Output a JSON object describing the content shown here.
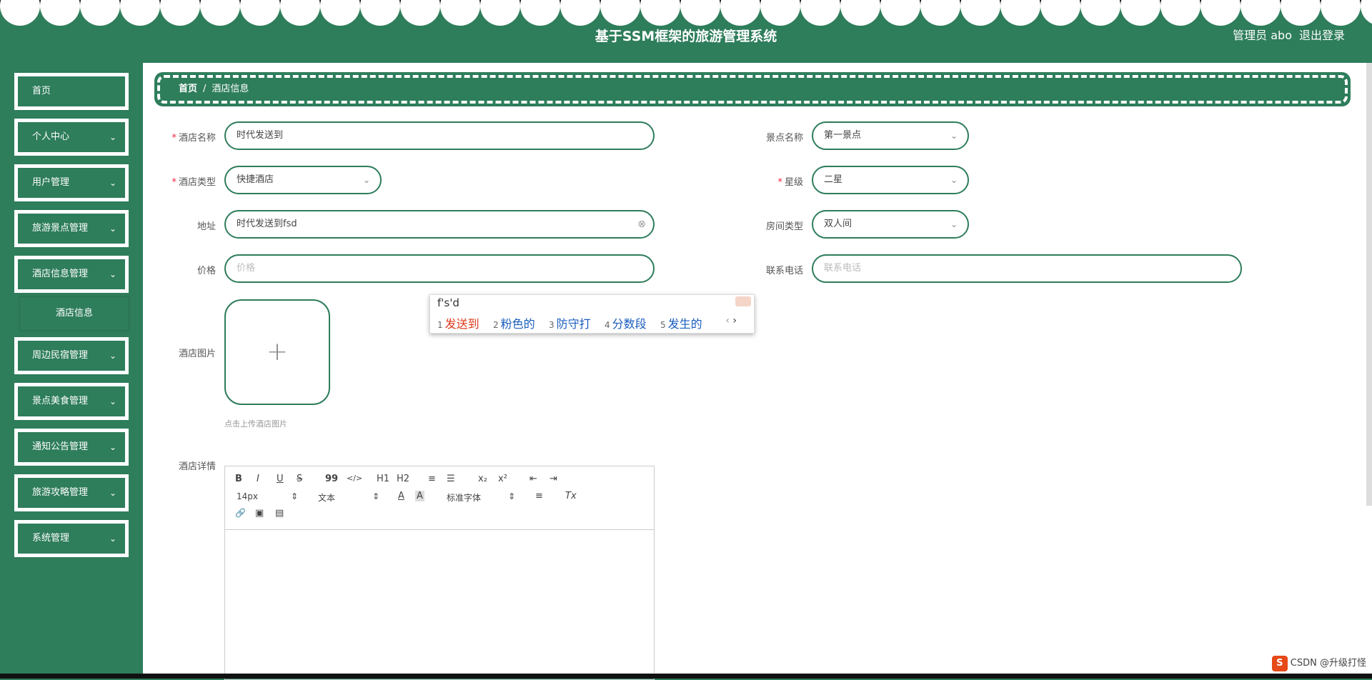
{
  "header": {
    "title": "基于SSM框架的旅游管理系统",
    "user": "管理员 abo",
    "logout": "退出登录"
  },
  "sidebar": {
    "items": [
      {
        "label": "首页"
      },
      {
        "label": "个人中心"
      },
      {
        "label": "用户管理"
      },
      {
        "label": "旅游景点管理"
      },
      {
        "label": "酒店信息管理"
      },
      {
        "label": "周边民宿管理"
      },
      {
        "label": "景点美食管理"
      },
      {
        "label": "通知公告管理"
      },
      {
        "label": "旅游攻略管理"
      },
      {
        "label": "系统管理"
      }
    ],
    "subitem": "酒店信息",
    "chevron": "⌄"
  },
  "breadcrumb": {
    "home": "首页",
    "separator": "/",
    "current": "酒店信息"
  },
  "form": {
    "hotel_name": {
      "label": "酒店名称",
      "value": "时代发送到"
    },
    "scenic_name": {
      "label": "景点名称",
      "value": "第一景点"
    },
    "hotel_type": {
      "label": "酒店类型",
      "value": "快捷酒店"
    },
    "star": {
      "label": "星级",
      "value": "二星"
    },
    "address": {
      "label": "地址",
      "value": "时代发送到fsd"
    },
    "room_type": {
      "label": "房间类型",
      "value": "双人间"
    },
    "price": {
      "label": "价格",
      "placeholder": "价格"
    },
    "phone": {
      "label": "联系电话",
      "placeholder": "联系电话"
    },
    "image": {
      "label": "酒店图片",
      "tip": "点击上传酒店图片",
      "plus": "+"
    },
    "detail": {
      "label": "酒店详情"
    },
    "required_mark": "*"
  },
  "editor": {
    "buttons": [
      "B",
      "I",
      "U",
      "S",
      "99",
      "</>",
      "H1",
      "H2",
      "≡",
      "☰",
      "x₂",
      "x²",
      "⇤",
      "⇥"
    ],
    "font_size": "14px",
    "block": "文本",
    "font_family": "标准字体",
    "misc": [
      "A",
      "A",
      "≡",
      "Tx"
    ],
    "row3": [
      "🔗",
      "▣",
      "▤"
    ]
  },
  "ime": {
    "typed": "f's'd",
    "candidates": [
      {
        "n": "1",
        "text": "发送到"
      },
      {
        "n": "2",
        "text": "粉色的"
      },
      {
        "n": "3",
        "text": "防守打"
      },
      {
        "n": "4",
        "text": "分数段"
      },
      {
        "n": "5",
        "text": "发生的"
      }
    ],
    "prev": "‹",
    "next": "›"
  },
  "watermark": "CSDN @升级打怪",
  "colors": {
    "primary": "#2e7d5b",
    "required": "#ee2244",
    "ime_first": "#e03b1d",
    "ime_cand": "#1a5dbf"
  }
}
